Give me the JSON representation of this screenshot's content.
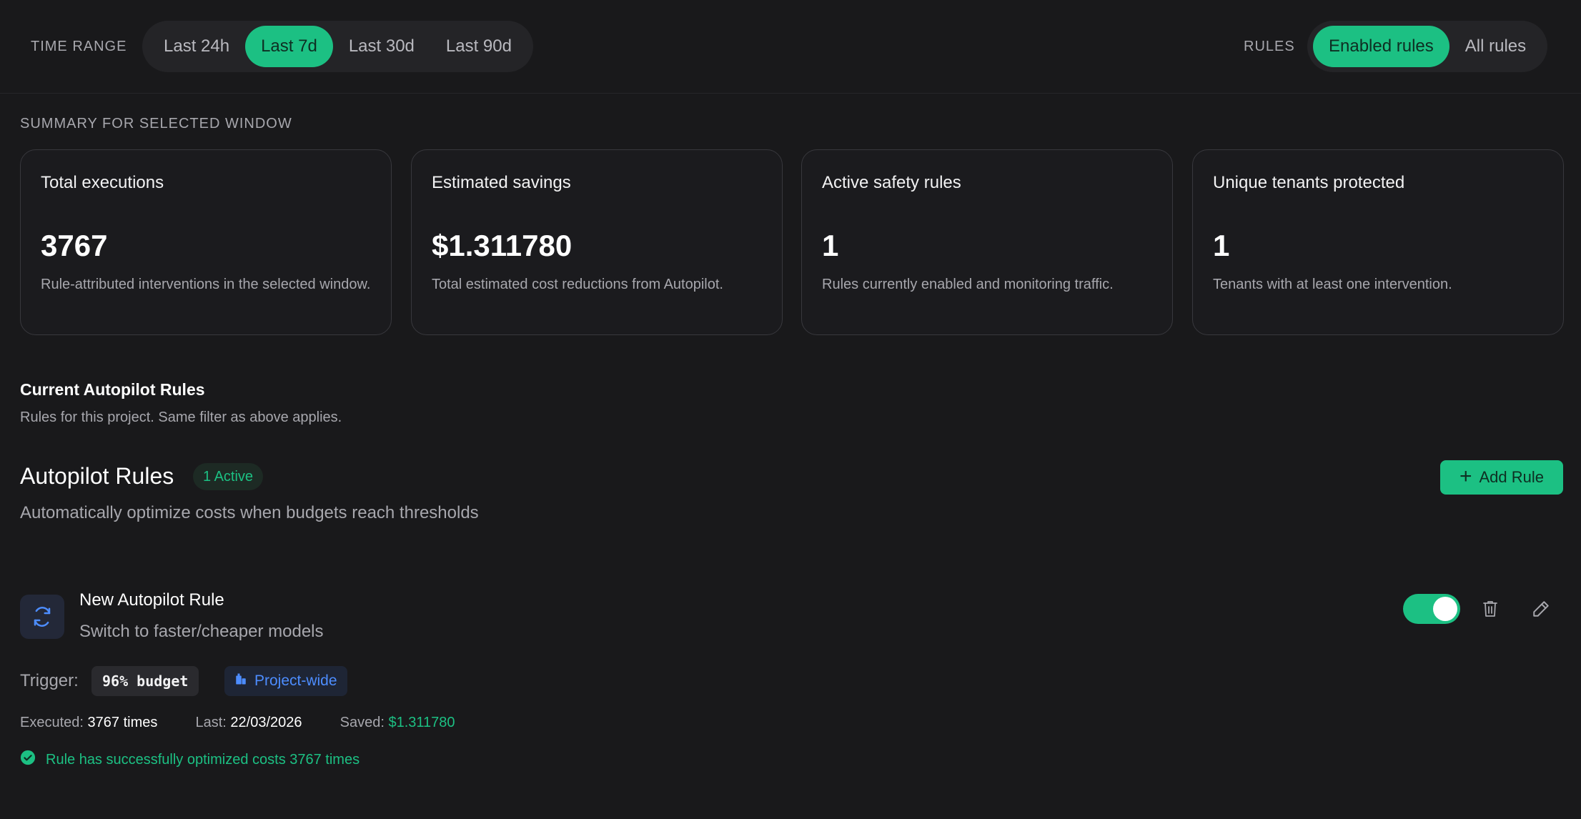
{
  "filters": {
    "time_range_label": "TIME RANGE",
    "time_range_options": [
      "Last 24h",
      "Last 7d",
      "Last 30d",
      "Last 90d"
    ],
    "time_range_selected": "Last 7d",
    "rules_label": "RULES",
    "rules_options": [
      "Enabled rules",
      "All rules"
    ],
    "rules_selected": "Enabled rules"
  },
  "summary": {
    "caption": "SUMMARY FOR SELECTED WINDOW",
    "cards": [
      {
        "title": "Total executions",
        "value": "3767",
        "desc": "Rule-attributed interventions in the selected window."
      },
      {
        "title": "Estimated savings",
        "value": "$1.311780",
        "desc": "Total estimated cost reductions from Autopilot."
      },
      {
        "title": "Active safety rules",
        "value": "1",
        "desc": "Rules currently enabled and monitoring traffic."
      },
      {
        "title": "Unique tenants protected",
        "value": "1",
        "desc": "Tenants with at least one intervention."
      }
    ]
  },
  "current_rules": {
    "heading": "Current Autopilot Rules",
    "subtitle": "Rules for this project. Same filter as above applies."
  },
  "autopilot": {
    "title": "Autopilot Rules",
    "badge": "1 Active",
    "description": "Automatically optimize costs when budgets reach thresholds",
    "add_button_label": "Add Rule"
  },
  "rule": {
    "icon": "refresh-icon",
    "name": "New Autopilot Rule",
    "type": "Switch to faster/cheaper models",
    "enabled": true,
    "trigger_label": "Trigger:",
    "trigger_value": "96% budget",
    "scope": "Project-wide",
    "executed_label": "Executed:",
    "executed_value": "3767 times",
    "last_label": "Last:",
    "last_value": "22/03/2026",
    "saved_label": "Saved:",
    "saved_value": "$1.311780",
    "success_message": "Rule has successfully optimized costs 3767 times"
  },
  "colors": {
    "accent": "#1cc083",
    "background": "#19191b",
    "scope_blue": "#4d8dff"
  }
}
